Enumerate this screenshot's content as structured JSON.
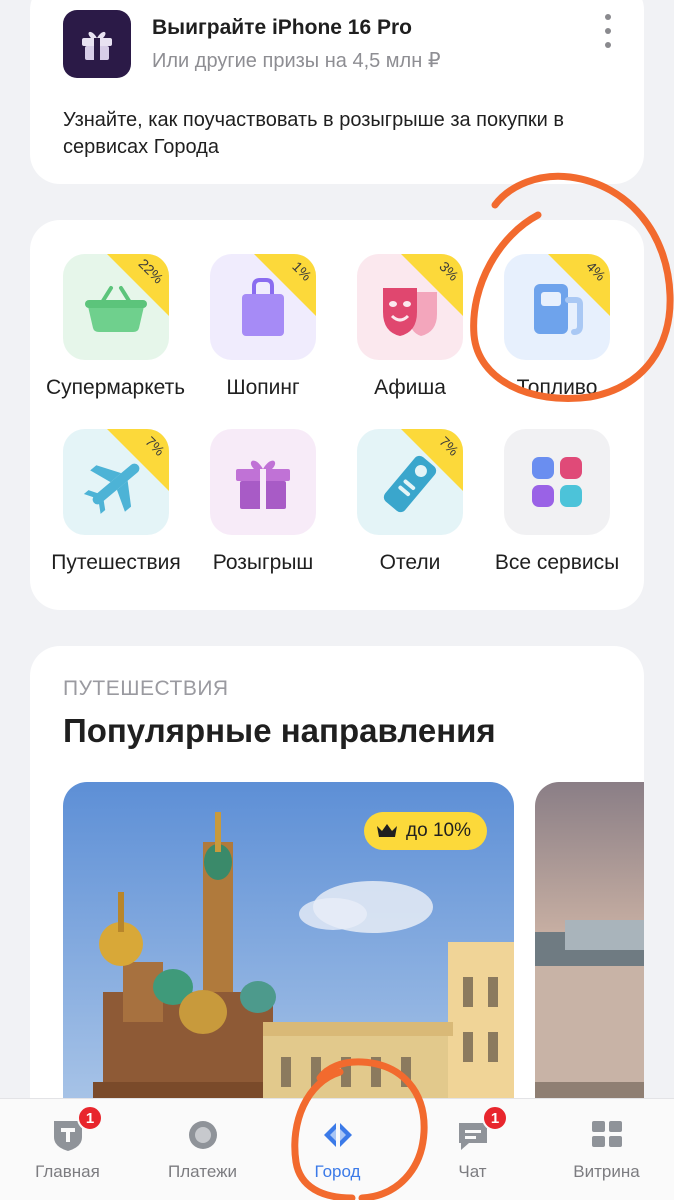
{
  "promo": {
    "title": "Выиграйте iPhone 16 Pro",
    "subtitle": "Или другие призы на 4,5 млн ₽",
    "text": "Узнайте, как поучаствовать в розыгрыше за покупки в сервисах Города",
    "logo_icon": "gift-icon",
    "menu_icon": "more-vertical-icon"
  },
  "services": [
    {
      "label": "Супермаркеты",
      "badge": "22%",
      "icon": "basket-icon",
      "tile_color": "#e6f6ea"
    },
    {
      "label": "Шопинг",
      "badge": "1%",
      "icon": "shopping-bag-icon",
      "tile_color": "#f0ecfd"
    },
    {
      "label": "Афиша",
      "badge": "3%",
      "icon": "theater-mask-icon",
      "tile_color": "#fbe8ee"
    },
    {
      "label": "Топливо",
      "badge": "4%",
      "icon": "fuel-pump-icon",
      "tile_color": "#e7f0fd"
    },
    {
      "label": "Путешествия",
      "badge": "7%",
      "icon": "airplane-icon",
      "tile_color": "#e4f4f7"
    },
    {
      "label": "Розыгрыш",
      "badge": "",
      "icon": "gift-icon",
      "tile_color": "#f7ebf8"
    },
    {
      "label": "Отели",
      "badge": "7%",
      "icon": "door-hanger-icon",
      "tile_color": "#e4f4f7"
    },
    {
      "label": "Все сервисы",
      "badge": "",
      "icon": "all-services-grid-icon",
      "tile_color": "#f1f1f3"
    }
  ],
  "travel": {
    "kicker": "ПУТЕШЕСТВИЯ",
    "title": "Популярные направления",
    "discount_label": "до 10%",
    "discount_icon": "crown-icon"
  },
  "tabbar": {
    "items": [
      {
        "label": "Главная",
        "icon": "home-shield-icon",
        "badge": "1",
        "active": false
      },
      {
        "label": "Платежи",
        "icon": "payments-circle-icon",
        "badge": "",
        "active": false
      },
      {
        "label": "Город",
        "icon": "city-diamond-icon",
        "badge": "",
        "active": true
      },
      {
        "label": "Чат",
        "icon": "chat-bubble-icon",
        "badge": "1",
        "active": false
      },
      {
        "label": "Витрина",
        "icon": "showcase-grid-icon",
        "badge": "",
        "active": false
      }
    ]
  },
  "colors": {
    "accent": "#3b7ae8",
    "badge_yellow": "#fcd93a",
    "notification_red": "#e8262d",
    "annotation_orange": "#f26a2e"
  }
}
